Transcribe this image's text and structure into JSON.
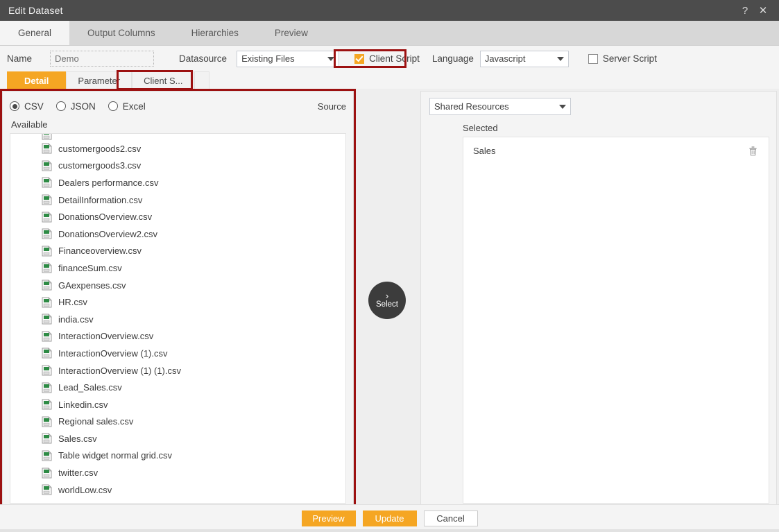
{
  "window": {
    "title": "Edit Dataset",
    "help_icon": "?",
    "close_icon": "✕"
  },
  "main_tabs": [
    {
      "label": "General",
      "active": true
    },
    {
      "label": "Output Columns",
      "active": false
    },
    {
      "label": "Hierarchies",
      "active": false
    },
    {
      "label": "Preview",
      "active": false
    }
  ],
  "form": {
    "name_label": "Name",
    "name_value": "Demo",
    "datasource_label": "Datasource",
    "datasource_value": "Existing Files",
    "client_script_label": "Client Script",
    "client_script_checked": true,
    "language_label": "Language",
    "language_value": "Javascript",
    "server_script_label": "Server Script",
    "server_script_checked": false
  },
  "sub_tabs": [
    {
      "label": "Detail",
      "active": true
    },
    {
      "label": "Parameter",
      "active": false
    },
    {
      "label": "Client S...",
      "active": false
    }
  ],
  "source": {
    "section_label": "Source",
    "types": [
      {
        "label": "CSV",
        "selected": true
      },
      {
        "label": "JSON",
        "selected": false
      },
      {
        "label": "Excel",
        "selected": false
      }
    ],
    "available_label": "Available",
    "files": [
      "customergoods2.csv",
      "customergoods3.csv",
      "Dealers performance.csv",
      "DetailInformation.csv",
      "DonationsOverview.csv",
      "DonationsOverview2.csv",
      "Financeoverview.csv",
      "financeSum.csv",
      "GAexpenses.csv",
      "HR.csv",
      "india.csv",
      "InteractionOverview.csv",
      "InteractionOverview (1).csv",
      "InteractionOverview (1) (1).csv",
      "Lead_Sales.csv",
      "Linkedin.csv",
      "Regional sales.csv",
      "Sales.csv",
      "Table widget normal grid.csv",
      "twitter.csv",
      "worldLow.csv"
    ]
  },
  "transfer": {
    "select_label": "Select",
    "chevron": "›"
  },
  "target": {
    "resource_value": "Shared Resources",
    "selected_label": "Selected",
    "selected_items": [
      {
        "name": "Sales",
        "delete_icon": "trash-icon"
      }
    ]
  },
  "footer": {
    "preview_label": "Preview",
    "update_label": "Update",
    "cancel_label": "Cancel"
  },
  "colors": {
    "accent": "#f5a623",
    "titlebar": "#4c4c4c",
    "highlight_box": "#9c1111"
  }
}
